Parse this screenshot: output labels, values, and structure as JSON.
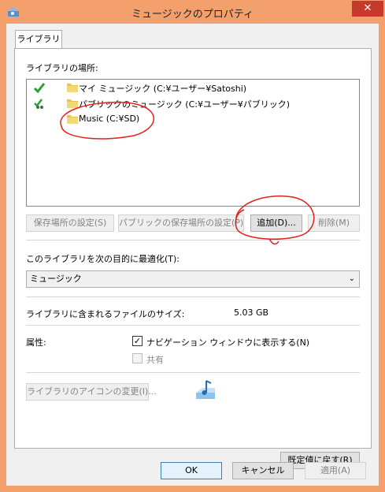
{
  "window": {
    "title": "ミュージックのプロパティ",
    "close_glyph": "✕"
  },
  "tabs": [
    {
      "label": "ライブラリ"
    }
  ],
  "locations": {
    "label": "ライブラリの場所:",
    "items": [
      {
        "status_icon": "checkmark-icon",
        "label": "マイ ミュージック (C:¥ユーザー¥Satoshi)"
      },
      {
        "status_icon": "public-checkmark-icon",
        "label": "パブリックのミュージック (C:¥ユーザー¥パブリック)"
      },
      {
        "status_icon": "",
        "label": "Music (C:¥SD)"
      }
    ],
    "buttons": {
      "set_save_location": "保存場所の設定(S)",
      "set_public_save_location": "パブリックの保存場所の設定(P)",
      "add": "追加(D)...",
      "remove": "削除(M)"
    }
  },
  "optimize": {
    "label": "このライブラリを次の目的に最適化(T):",
    "selected": "ミュージック"
  },
  "size": {
    "label": "ライブラリに含まれるファイルのサイズ:",
    "value": "5.03 GB"
  },
  "attributes": {
    "label": "属性:",
    "show_in_nav": {
      "label": "ナビゲーション ウィンドウに表示する(N)",
      "checked": true
    },
    "shared": {
      "label": "共有",
      "checked": false,
      "disabled": true
    }
  },
  "change_icon_button": "ライブラリのアイコンの変更(I)...",
  "restore_defaults_button": "既定値に戻す(R)",
  "footer": {
    "ok": "OK",
    "cancel": "キャンセル",
    "apply": "適用(A)"
  },
  "colors": {
    "frame": "#f3a06d",
    "close": "#c7392d",
    "annotation": "#e0201a"
  }
}
